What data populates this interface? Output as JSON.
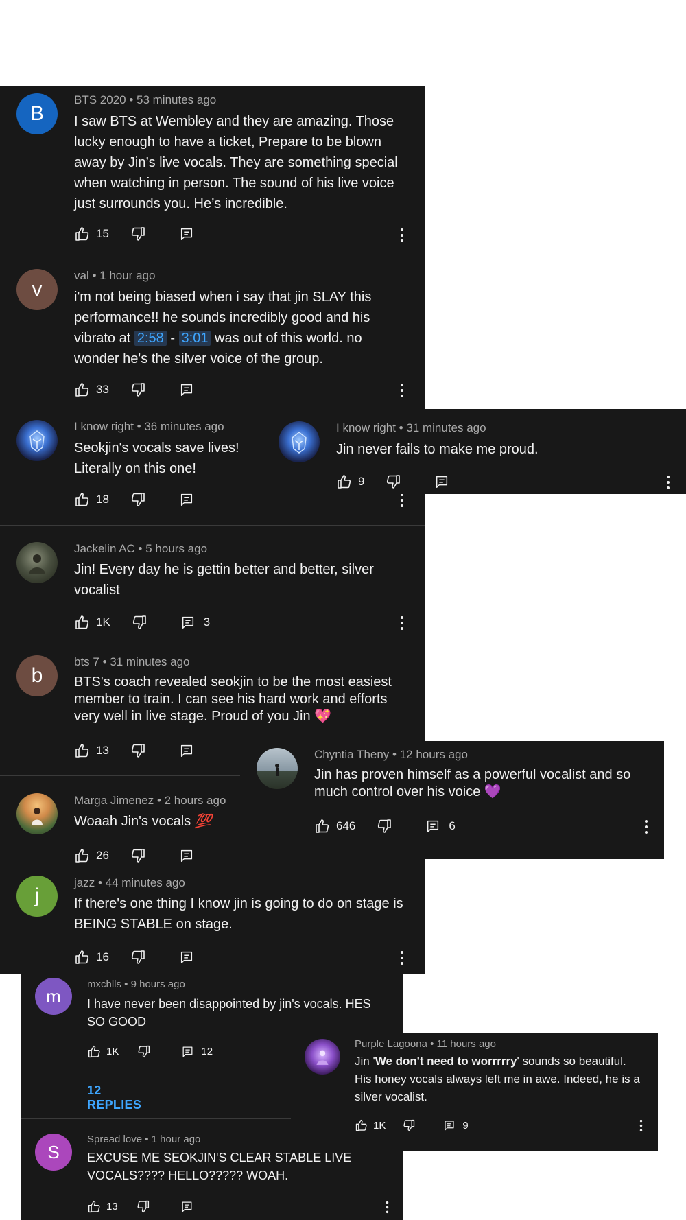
{
  "colors": {
    "background": "#181818",
    "page": "#ffffff",
    "text": "#f1f1f1",
    "meta": "#aaaaaa",
    "link": "#3ea6ff"
  },
  "comments": {
    "c1": {
      "initial": "B",
      "author": "BTS 2020",
      "time": "53 minutes ago",
      "text": "I saw BTS at Wembley and they are amazing. Those lucky enough to have a ticket, Prepare to be blown away by Jin’s live vocals. They are something special when watching in person. The sound of his live voice just surrounds you. He’s incredible.",
      "likes": "15"
    },
    "c2": {
      "initial": "v",
      "author": "val",
      "time": "1 hour ago",
      "text_a": "i'm not being biased when i say that jin SLAY this performance!! he sounds incredibly good and his vibrato at ",
      "ts1": "2:58",
      "dash": " - ",
      "ts2": "3:01",
      "text_b": " was out of this world. no wonder he's the silver voice of the group.",
      "likes": "33"
    },
    "c3": {
      "author": "I know right",
      "time": "36 minutes ago",
      "text": "Seokjin's vocals save lives! Literally on this one!",
      "likes": "18"
    },
    "c4": {
      "author": "I know right",
      "time": "31 minutes ago",
      "text": "Jin never fails to make me proud.",
      "likes": "9"
    },
    "c5": {
      "author": "Jackelin AC",
      "time": "5 hours ago",
      "text": "Jin! Every day he is gettin better and better, silver vocalist",
      "likes": "1K",
      "replies": "3"
    },
    "c6": {
      "initial": "b",
      "author": "bts 7",
      "time": "31 minutes ago",
      "text": "BTS's coach revealed seokjin to be the most easiest member to train. I can see his hard work and efforts very well in live stage. Proud of you Jin",
      "emoji": "💖",
      "likes": "13"
    },
    "c7": {
      "author": "Chyntia Theny",
      "time": "12 hours ago",
      "text": "Jin has proven himself as a powerful vocalist and so much control over his voice",
      "emoji": "💜",
      "likes": "646",
      "replies": "6"
    },
    "c8": {
      "author": "Marga Jimenez",
      "time": "2 hours ago",
      "text": "Woaah Jin's vocals",
      "emoji": "💯",
      "likes": "26"
    },
    "c9": {
      "initial": "j",
      "author": "jazz",
      "time": "44 minutes ago",
      "text": "If there's one thing I know jin is going to do on stage is BEING STABLE on stage.",
      "likes": "16"
    },
    "c10": {
      "initial": "m",
      "author": "mxchlls",
      "time": "9 hours ago",
      "text": "I have never been disappointed by jin's vocals. HES SO GOOD",
      "likes": "1K",
      "replies": "12",
      "replies_link": "12 REPLIES"
    },
    "c11": {
      "author": "Purple Lagoona",
      "time": "11 hours ago",
      "text_a": "Jin '",
      "bold": "We don't need to worrrrry",
      "text_b": "' sounds so beautiful. His honey vocals always left me in awe. Indeed, he is a silver vocalist.",
      "likes": "1K",
      "replies": "9"
    },
    "c12": {
      "initial": "S",
      "author": "Spread love",
      "time": "1 hour ago",
      "text": "EXCUSE ME SEOKJIN'S CLEAR STABLE LIVE VOCALS???? HELLO????? WOAH.",
      "likes": "13"
    }
  },
  "sep": " • ",
  "icons": [
    "like-icon",
    "dislike-icon",
    "reply-icon",
    "more-vert-icon"
  ]
}
